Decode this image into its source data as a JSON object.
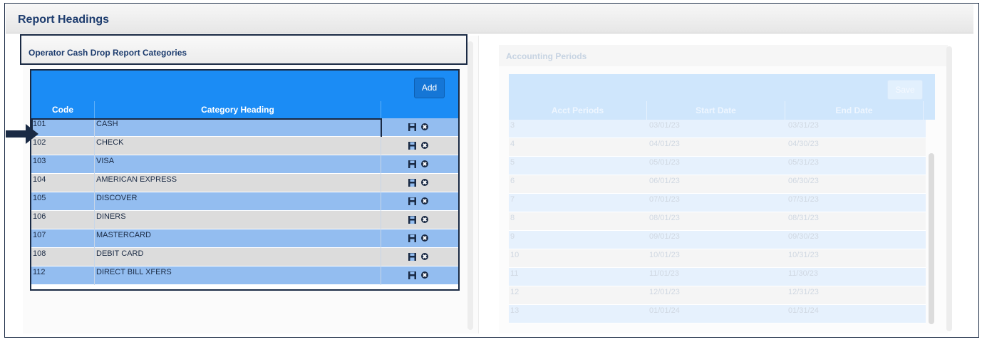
{
  "page": {
    "title": "Report Headings"
  },
  "left": {
    "section_title": "Operator Cash Drop Report Categories",
    "add_label": "Add",
    "columns": [
      "Code",
      "Category Heading",
      ""
    ],
    "rows": [
      {
        "code": "101",
        "heading": "CASH"
      },
      {
        "code": "102",
        "heading": "CHECK"
      },
      {
        "code": "103",
        "heading": "VISA"
      },
      {
        "code": "104",
        "heading": "AMERICAN EXPRESS"
      },
      {
        "code": "105",
        "heading": "DISCOVER"
      },
      {
        "code": "106",
        "heading": "DINERS"
      },
      {
        "code": "107",
        "heading": "MASTERCARD"
      },
      {
        "code": "108",
        "heading": "DEBIT CARD"
      },
      {
        "code": "112",
        "heading": "DIRECT BILL XFERS"
      }
    ],
    "row_icons": [
      "save-icon",
      "delete-icon"
    ]
  },
  "right": {
    "section_title": "Accounting Periods",
    "save_label": "Save",
    "columns": [
      "Acct Periods",
      "Start Date",
      "End Date"
    ],
    "rows": [
      {
        "period": "3",
        "start": "03/01/23",
        "end": "03/31/23"
      },
      {
        "period": "4",
        "start": "04/01/23",
        "end": "04/30/23"
      },
      {
        "period": "5",
        "start": "05/01/23",
        "end": "05/31/23"
      },
      {
        "period": "6",
        "start": "06/01/23",
        "end": "06/30/23"
      },
      {
        "period": "7",
        "start": "07/01/23",
        "end": "07/31/23"
      },
      {
        "period": "8",
        "start": "08/01/23",
        "end": "08/31/23"
      },
      {
        "period": "9",
        "start": "09/01/23",
        "end": "09/30/23"
      },
      {
        "period": "10",
        "start": "10/01/23",
        "end": "10/31/23"
      },
      {
        "period": "11",
        "start": "11/01/23",
        "end": "11/30/23"
      },
      {
        "period": "12",
        "start": "12/01/23",
        "end": "12/31/23"
      },
      {
        "period": "13",
        "start": "01/01/24",
        "end": "01/31/24"
      }
    ]
  },
  "colors": {
    "primary": "#1b8cf5",
    "row_blue": "#93bdf0",
    "row_gray": "#dcdcdc",
    "title_text": "#1d3c6e",
    "highlight_border": "#1a2a44"
  }
}
